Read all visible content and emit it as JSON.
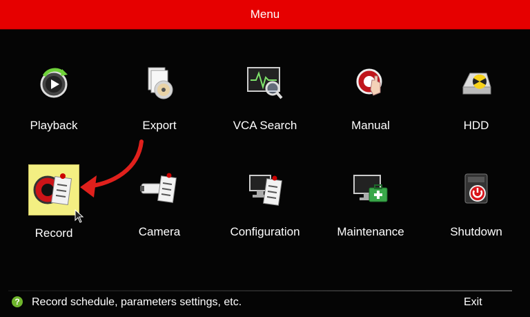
{
  "window": {
    "title": "Menu"
  },
  "menu": {
    "items": [
      {
        "label": "Playback",
        "icon": "playback-icon"
      },
      {
        "label": "Export",
        "icon": "export-disc-icon"
      },
      {
        "label": "VCA Search",
        "icon": "vca-search-icon"
      },
      {
        "label": "Manual",
        "icon": "manual-record-icon"
      },
      {
        "label": "HDD",
        "icon": "hdd-icon"
      },
      {
        "label": "Record",
        "icon": "record-icon",
        "selected": true
      },
      {
        "label": "Camera",
        "icon": "camera-icon"
      },
      {
        "label": "Configuration",
        "icon": "configuration-icon"
      },
      {
        "label": "Maintenance",
        "icon": "maintenance-icon"
      },
      {
        "label": "Shutdown",
        "icon": "shutdown-icon"
      }
    ]
  },
  "status": {
    "help_text": "Record schedule, parameters settings, etc.",
    "help_icon": "?",
    "exit_label": "Exit"
  },
  "colors": {
    "title_bar": "#e60000",
    "background": "#050505",
    "selected_highlight": "#f3ef82",
    "annotation_arrow": "#e0201c"
  }
}
